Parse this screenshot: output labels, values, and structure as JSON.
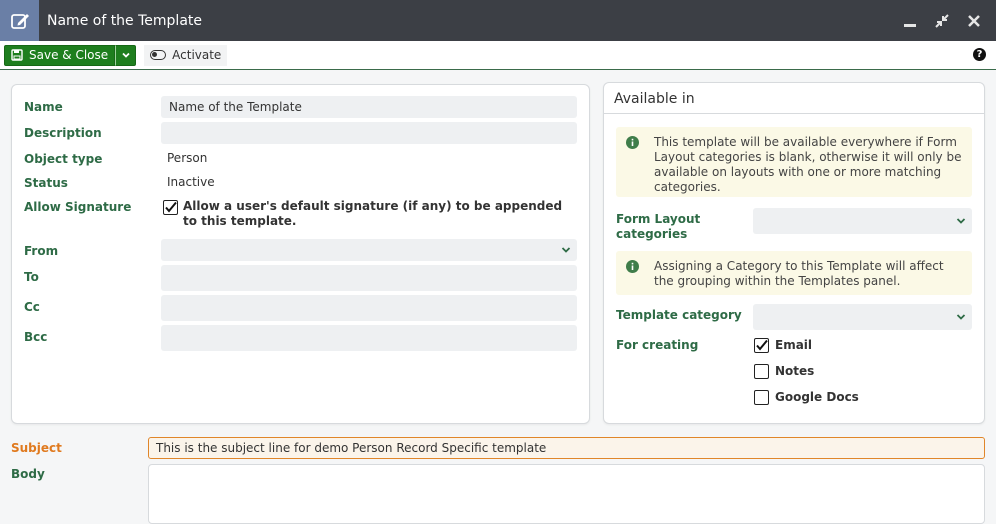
{
  "window": {
    "title": "Name of the Template",
    "icon": "edit-icon",
    "controls": [
      "minimize-icon",
      "restore-icon",
      "close-icon"
    ]
  },
  "toolbar": {
    "save_label": "Save & Close",
    "activate_label": "Activate",
    "help_label": "?"
  },
  "left": {
    "name_label": "Name",
    "name_value": "Name of the Template",
    "description_label": "Description",
    "description_value": "",
    "object_type_label": "Object type",
    "object_type_value": "Person",
    "status_label": "Status",
    "status_value": "Inactive",
    "allow_signature_label": "Allow Signature",
    "allow_signature_text": "Allow a user's default signature (if any) to be appended to this template.",
    "allow_signature_checked": true,
    "from_label": "From",
    "from_value": "",
    "to_label": "To",
    "to_value": "",
    "cc_label": "Cc",
    "cc_value": "",
    "bcc_label": "Bcc",
    "bcc_value": ""
  },
  "right": {
    "header": "Available in",
    "info1": "This template will be available everywhere if Form Layout categories is blank, otherwise it will only be available on layouts with one or more matching categories.",
    "form_layout_label": "Form Layout categories",
    "form_layout_value": "",
    "info2": "Assigning a Category to this Template will affect the grouping within the Templates panel.",
    "template_category_label": "Template category",
    "template_category_value": "",
    "for_creating_label": "For creating",
    "options": [
      {
        "label": "Email",
        "checked": true
      },
      {
        "label": "Notes",
        "checked": false
      },
      {
        "label": "Google Docs",
        "checked": false
      }
    ]
  },
  "subject": {
    "label": "Subject",
    "value": "This is the subject line for demo Person Record Specific template"
  },
  "body": {
    "label": "Body",
    "value": ""
  },
  "colors": {
    "titlebar": "#3c3f45",
    "title_icon_bg": "#6a7fa6",
    "save_green": "#1e7e1e",
    "label_green": "#2e6b46",
    "subject_orange": "#e07a1f",
    "info_bg": "#fbf9e6"
  }
}
